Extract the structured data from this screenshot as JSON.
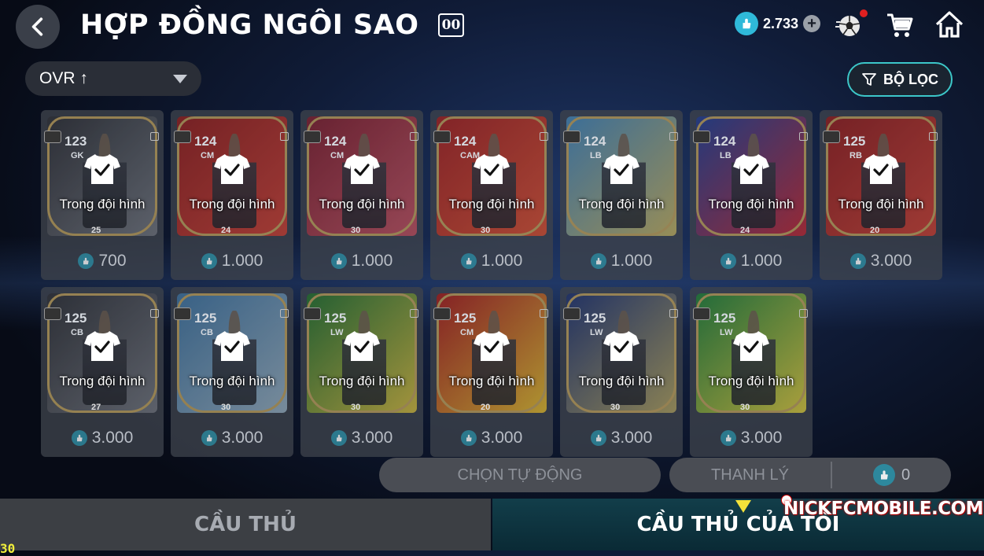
{
  "header": {
    "title": "HỢP ĐỒNG NGÔI SAO",
    "badge": "00",
    "currency_amount": "2.733"
  },
  "toolbar": {
    "sort_label": "OVR ↑",
    "filter_label": "BỘ LỌC"
  },
  "cards": [
    {
      "ovr": "123",
      "pos": "GK",
      "badge": "25",
      "status": "Trong đội hình",
      "price": "700",
      "colors": [
        "#2b2d33",
        "#6b6f78"
      ]
    },
    {
      "ovr": "124",
      "pos": "CM",
      "badge": "24",
      "status": "Trong đội hình",
      "price": "1.000",
      "colors": [
        "#8c1a1a",
        "#c33b2f"
      ]
    },
    {
      "ovr": "124",
      "pos": "CM",
      "badge": "30",
      "status": "Trong đội hình",
      "price": "1.000",
      "colors": [
        "#7a1b2a",
        "#b84b5a"
      ]
    },
    {
      "ovr": "124",
      "pos": "CAM",
      "badge": "30",
      "status": "Trong đội hình",
      "price": "1.000",
      "colors": [
        "#9c1c1c",
        "#d04a2c"
      ]
    },
    {
      "ovr": "124",
      "pos": "LB",
      "badge": "",
      "status": "Trong đội hình",
      "price": "1.000",
      "colors": [
        "#3f7fb1",
        "#b9a85a"
      ]
    },
    {
      "ovr": "124",
      "pos": "LB",
      "badge": "24",
      "status": "Trong đội hình",
      "price": "1.000",
      "colors": [
        "#1d3a8c",
        "#b8232f"
      ]
    },
    {
      "ovr": "125",
      "pos": "RB",
      "badge": "20",
      "status": "Trong đội hình",
      "price": "3.000",
      "colors": [
        "#8c1a1a",
        "#c33b2f"
      ]
    },
    {
      "ovr": "125",
      "pos": "CB",
      "badge": "27",
      "status": "Trong đội hình",
      "price": "3.000",
      "colors": [
        "#2b2d33",
        "#6b6f78"
      ]
    },
    {
      "ovr": "125",
      "pos": "CB",
      "badge": "30",
      "status": "Trong đội hình",
      "price": "3.000",
      "colors": [
        "#3a6e9a",
        "#8fa7b8"
      ]
    },
    {
      "ovr": "125",
      "pos": "LW",
      "badge": "30",
      "status": "Trong đội hình",
      "price": "3.000",
      "colors": [
        "#1f6b2a",
        "#c9b23a"
      ]
    },
    {
      "ovr": "125",
      "pos": "CM",
      "badge": "20",
      "status": "Trong đội hình",
      "price": "3.000",
      "colors": [
        "#a01818",
        "#d8b32a"
      ]
    },
    {
      "ovr": "125",
      "pos": "LW",
      "badge": "30",
      "status": "Trong đội hình",
      "price": "3.000",
      "colors": [
        "#1c2f6a",
        "#a89a5a"
      ]
    },
    {
      "ovr": "125",
      "pos": "LW",
      "badge": "30",
      "status": "Trong đội hình",
      "price": "3.000",
      "colors": [
        "#1c7a33",
        "#d2c23a"
      ]
    }
  ],
  "actions": {
    "auto_select": "CHỌN TỰ ĐỘNG",
    "sell": "THANH LÝ",
    "sell_total": "0"
  },
  "tabs": {
    "players": "CẦU THỦ",
    "my_players": "CẦU THỦ CỦA TÔI"
  },
  "watermark": "NICKFCMOBILE.COM",
  "fps": "30"
}
